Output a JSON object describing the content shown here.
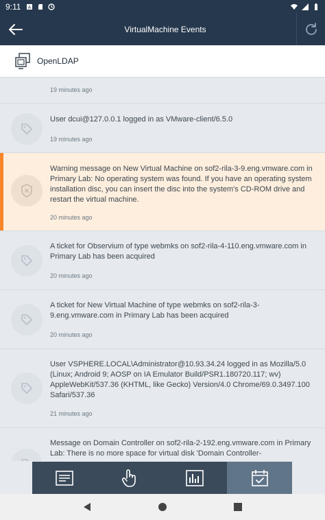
{
  "status_bar": {
    "time": "9:11"
  },
  "app_bar": {
    "title": "VirtualMachine Events"
  },
  "vm": {
    "name": "OpenLDAP"
  },
  "events": [
    {
      "message": "",
      "time": "19 minutes ago",
      "icon": "tag-icon",
      "severity": "info"
    },
    {
      "message": "User dcui@127.0.0.1 logged in as VMware-client/6.5.0",
      "time": "19 minutes ago",
      "icon": "tag-icon",
      "severity": "info"
    },
    {
      "message": "Warning message on New Virtual Machine on sof2-rila-3-9.eng.vmware.com in Primary Lab: No operating system was found. If you have an operating system installation disc, you can insert the disc into the system's CD-ROM drive and restart the virtual machine.",
      "time": "20 minutes ago",
      "icon": "warning-shield-icon",
      "severity": "warning"
    },
    {
      "message": "A ticket for Observium of type webmks on sof2-rila-4-110.eng.vmware.com in Primary Lab has been acquired",
      "time": "20 minutes ago",
      "icon": "tag-icon",
      "severity": "info"
    },
    {
      "message": "A ticket for New Virtual Machine of type webmks on sof2-rila-3-9.eng.vmware.com in Primary Lab has been acquired",
      "time": "20 minutes ago",
      "icon": "tag-icon",
      "severity": "info"
    },
    {
      "message": "User VSPHERE.LOCAL\\Administrator@10.93.34.24 logged in as Mozilla/5.0 (Linux; Android 9; AOSP on IA Emulator Build/PSR1.180720.117; wv) AppleWebKit/537.36 (KHTML, like Gecko) Version/4.0 Chrome/69.0.3497.100 Safari/537.36",
      "time": "21 minutes ago",
      "icon": "tag-icon",
      "severity": "info"
    },
    {
      "message": "Message on Domain Controller on sof2-rila-2-192.eng.vmware.com in Primary Lab: There is no more space for virtual disk 'Domain Controller-",
      "time": "",
      "icon": "tag-icon",
      "severity": "info"
    }
  ],
  "bottom_tabs": [
    {
      "name": "summary",
      "icon": "summary-list-icon",
      "active": false
    },
    {
      "name": "actions",
      "icon": "hand-pointer-icon",
      "active": false
    },
    {
      "name": "monitor",
      "icon": "chart-icon",
      "active": false
    },
    {
      "name": "events",
      "icon": "calendar-check-icon",
      "active": true
    }
  ],
  "colors": {
    "header": "#26384d",
    "warning_accent": "#f7862a",
    "warning_bg": "#fdeedd",
    "list_bg": "#e6eaee",
    "tabbar": "#3a4a5a",
    "tab_active": "#617589"
  }
}
